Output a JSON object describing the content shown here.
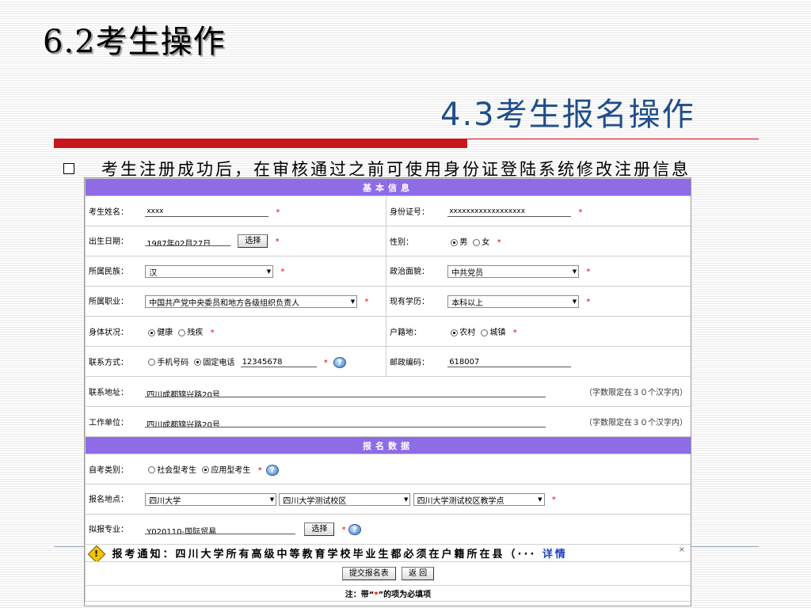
{
  "slide": {
    "title": "6.2考生操作",
    "subtitle": "4.3考生报名操作",
    "bullet": "考生注册成功后，在审核通过之前可使用身份证登陆系统修改注册信息"
  },
  "form": {
    "basic_header": "基本信息",
    "name": {
      "label": "考生姓名：",
      "value": "xxxx"
    },
    "id_card": {
      "label": "身份证号：",
      "value": "xxxxxxxxxxxxxxxxxx"
    },
    "birth": {
      "label": "出生日期：",
      "value": "1987年02月27日",
      "button": "选择"
    },
    "gender": {
      "label": "性别：",
      "options": [
        "男",
        "女"
      ],
      "selected": "男"
    },
    "ethnicity": {
      "label": "所属民族：",
      "value": "汉"
    },
    "political": {
      "label": "政治面貌：",
      "value": "中共党员"
    },
    "occupation": {
      "label": "所属职业：",
      "value": "中国共产党中央委员和地方各级组织负责人"
    },
    "education": {
      "label": "现有学历：",
      "value": "本科以上"
    },
    "health": {
      "label": "身体状况：",
      "options": [
        "健康",
        "残疾"
      ],
      "selected": "健康"
    },
    "household": {
      "label": "户籍地：",
      "options": [
        "农村",
        "城镇"
      ],
      "selected": "农村"
    },
    "contact": {
      "label": "联系方式：",
      "options": [
        "手机号码",
        "固定电话"
      ],
      "selected": "固定电话",
      "value": "12345678"
    },
    "postcode": {
      "label": "邮政编码：",
      "value": "618007"
    },
    "address": {
      "label": "联系地址：",
      "value": "四川成都锦兴路20号",
      "hint": "（字数限定在３０个汉字内）"
    },
    "workplace": {
      "label": "工作单位：",
      "value": "四川成都锦兴路20号",
      "hint": "（字数限定在３０个汉字内）"
    },
    "apply_header": "报名数据",
    "exam_type": {
      "label": "自考类别：",
      "options": [
        "社会型考生",
        "应用型考生"
      ],
      "selected": "应用型考生"
    },
    "location": {
      "label": "报名地点：",
      "values": [
        "四川大学",
        "四川大学测试校区",
        "四川大学测试校区教学点"
      ]
    },
    "major": {
      "label": "拟报专业：",
      "value": "Y020110-国际贸易",
      "button": "选择"
    },
    "notice": {
      "text": "报考通知：四川大学所有高级中等教育学校毕业生都必须在户籍所在县（···",
      "link": "详情",
      "close": "×"
    },
    "submit_label": "提交报名表",
    "back_label": "返 回",
    "note": {
      "prefix": "注：带“",
      "star": "*",
      "suffix": "”的项为必填项"
    },
    "required_mark": "*",
    "help_glyph": "?"
  },
  "colors": {
    "header_bg": "#8d6ce6",
    "title_bar": "#c8161d",
    "subtitle": "#1f4e8a",
    "required": "#e60000"
  },
  "icons": [
    "help-icon",
    "warning-icon",
    "close-icon",
    "dropdown-arrow-icon"
  ]
}
